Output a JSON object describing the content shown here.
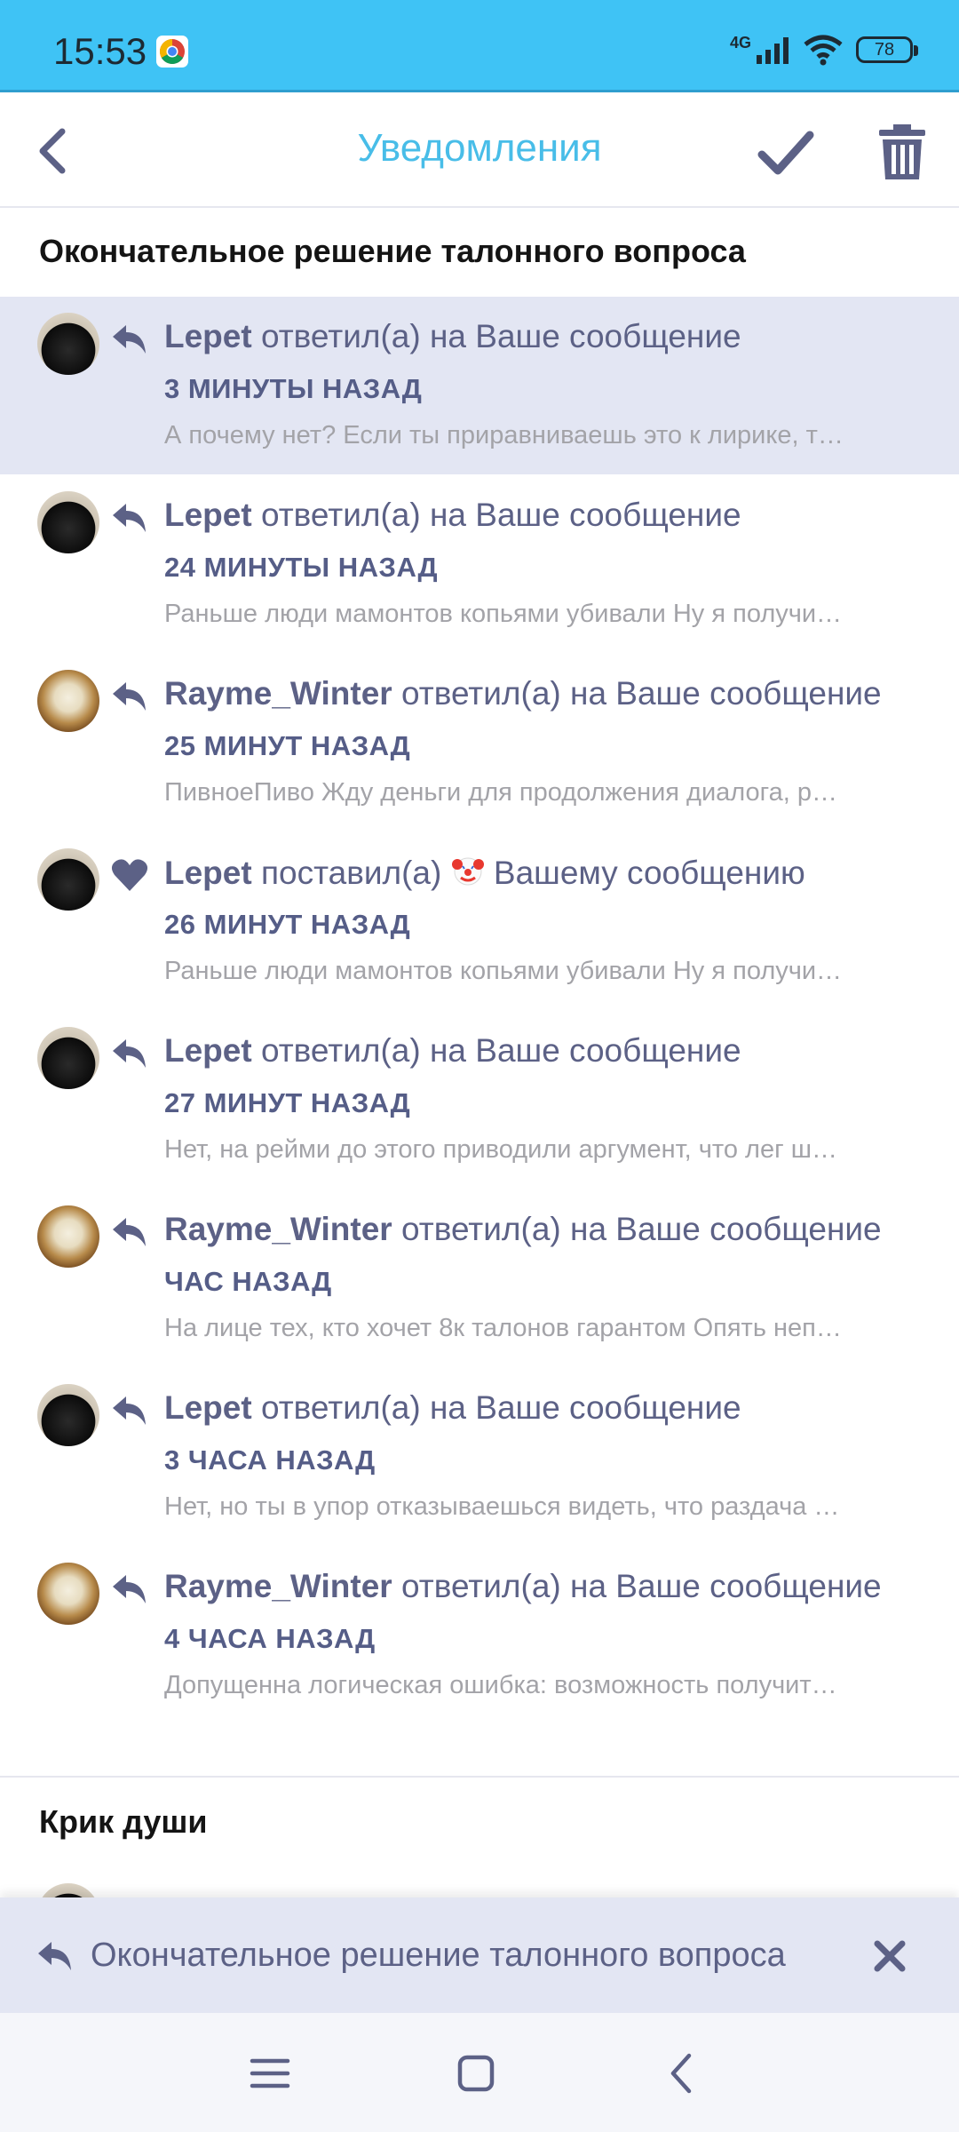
{
  "status_bar": {
    "time": "15:53",
    "network": "4G",
    "battery": "78",
    "icons": [
      "chrome-icon",
      "signal-icon",
      "wifi-icon",
      "battery-icon"
    ]
  },
  "header": {
    "title": "Уведомления",
    "back_icon": "chevron-left-icon",
    "mark_read_icon": "check-icon",
    "delete_icon": "trash-icon",
    "title_color": "#48bde8"
  },
  "sections": [
    {
      "title": "Окончательное решение талонного вопроса",
      "notifications": [
        {
          "user": "Lepet",
          "avatar": "black-cat-avatar",
          "icon": "reply-icon",
          "action": "ответил(а) на Ваше сообщение",
          "time": "3 МИНУТЫ НАЗАД",
          "snippet": "А почему нет? Если ты приравниваешь это к лирике, т…",
          "unread": true
        },
        {
          "user": "Lepet",
          "avatar": "black-cat-avatar",
          "icon": "reply-icon",
          "action": "ответил(а) на Ваше сообщение",
          "time": "24 МИНУТЫ НАЗАД",
          "snippet": "Раньше люди мамонтов копьями убивали Ну я получи…",
          "unread": false
        },
        {
          "user": "Rayme_Winter",
          "avatar": "dumplings-avatar",
          "icon": "reply-icon",
          "action": "ответил(а) на Ваше сообщение",
          "time": "25 МИНУТ НАЗАД",
          "snippet": "ПивноеПиво Жду деньги для продолжения диалога, р…",
          "unread": false
        },
        {
          "user": "Lepet",
          "avatar": "black-cat-avatar",
          "icon": "heart-icon",
          "action": "поставил(а)",
          "reaction": "clown-emoji",
          "action_suffix": "Вашему сообщению",
          "time": "26 МИНУТ НАЗАД",
          "snippet": "Раньше люди мамонтов копьями убивали Ну я получи…",
          "unread": false
        },
        {
          "user": "Lepet",
          "avatar": "black-cat-avatar",
          "icon": "reply-icon",
          "action": "ответил(а) на Ваше сообщение",
          "time": "27 МИНУТ НАЗАД",
          "snippet": "Нет, на рейми до этого приводили аргумент, что лег ш…",
          "unread": false
        },
        {
          "user": "Rayme_Winter",
          "avatar": "dumplings-avatar",
          "icon": "reply-icon",
          "action": "ответил(а) на Ваше сообщение",
          "time": "ЧАС НАЗАД",
          "snippet": "На лице тех, кто хочет 8к талонов гарантом Опять неп…",
          "unread": false
        },
        {
          "user": "Lepet",
          "avatar": "black-cat-avatar",
          "icon": "reply-icon",
          "action": "ответил(а) на Ваше сообщение",
          "time": "3 ЧАСА НАЗАД",
          "snippet": "Нет, но ты в упор отказываешься видеть, что раздача …",
          "unread": false
        },
        {
          "user": "Rayme_Winter",
          "avatar": "dumplings-avatar",
          "icon": "reply-icon",
          "action": "ответил(а) на Ваше сообщение",
          "time": "4 ЧАСА НАЗАД",
          "snippet": "Допущенна логическая ошибка: возможность получит…",
          "unread": false
        }
      ]
    },
    {
      "title": "Крик души"
    }
  ],
  "thread_bar": {
    "label": "Окончательное решение талонного вопроса",
    "icon": "reply-icon",
    "close_icon": "close-icon"
  },
  "nav_bar": {
    "icons": [
      "menu-icon",
      "home-square-icon",
      "back-triangle-icon"
    ]
  },
  "colors": {
    "accent": "#48bde8",
    "status_bar": "#3fc3f5",
    "unread_bg": "#e3e6f3",
    "text_primary": "#5c6186"
  }
}
